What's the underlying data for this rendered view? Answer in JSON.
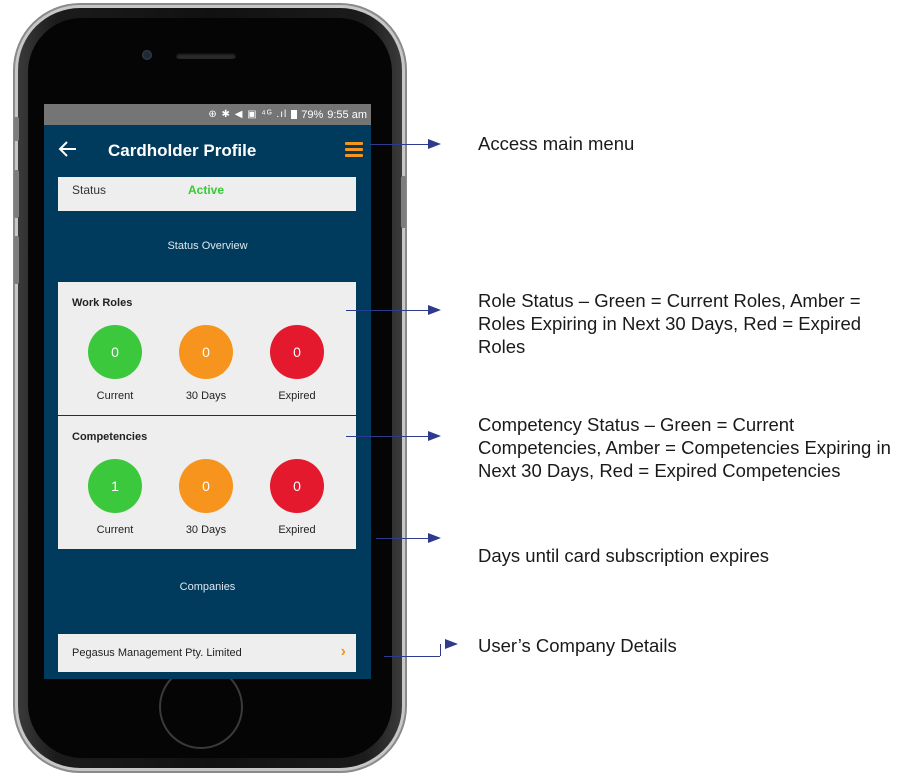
{
  "statusbar": {
    "icons": "⊕ ✱ ◀ ▣ ⁴ᴳ .ıl",
    "battery": "79%",
    "time": "9:55 am"
  },
  "appbar": {
    "title": "Cardholder Profile"
  },
  "status_row": {
    "label": "Status",
    "value": "Active"
  },
  "status_overview_heading": "Status Overview",
  "work_roles": {
    "title": "Work Roles",
    "current": {
      "count": "0",
      "label": "Current"
    },
    "days30": {
      "count": "0",
      "label": "30 Days"
    },
    "expired": {
      "count": "0",
      "label": "Expired"
    }
  },
  "competencies": {
    "title": "Competencies",
    "current": {
      "count": "1",
      "label": "Current"
    },
    "days30": {
      "count": "0",
      "label": "30 Days"
    },
    "expired": {
      "count": "0",
      "label": "Expired"
    }
  },
  "companies_heading": "Companies",
  "company": {
    "name": "Pegasus Management Pty. Limited"
  },
  "annotations": {
    "menu": "Access main menu",
    "roles": "Role Status – Green = Current Roles, Amber = Roles Expiring in Next 30 Days, Red = Expired Roles",
    "competency": "Competency Status – Green = Current Competencies, Amber = Competencies Expiring in Next 30 Days, Red = Expired Competencies",
    "subscription": "Days until card subscription expires",
    "company": "User’s Company Details"
  },
  "colors": {
    "navy": "#003a5c",
    "green": "#3cc83c",
    "amber": "#f7941d",
    "red": "#e4192e",
    "arrow": "#2e3a8c"
  }
}
